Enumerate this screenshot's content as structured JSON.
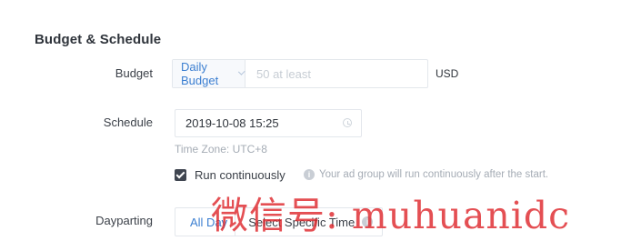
{
  "section": {
    "title": "Budget & Schedule"
  },
  "budget": {
    "label": "Budget",
    "type_selected": "Daily Budget",
    "amount_placeholder": "50 at least",
    "currency": "USD"
  },
  "schedule": {
    "label": "Schedule",
    "start_datetime": "2019-10-08 15:25",
    "timezone": "Time Zone: UTC+8",
    "run_continuously": {
      "checked": true,
      "label": "Run continuously",
      "hint": "Your ad group will run continuously after the start."
    }
  },
  "dayparting": {
    "label": "Dayparting",
    "options": [
      "All Day",
      "Select Specific Time"
    ],
    "selected": "All Day"
  },
  "icons": {
    "budget_chevron": "chevron-down-icon",
    "schedule_clock": "clock-icon",
    "run_hint": "info-icon",
    "dayparting_hint": "info-icon"
  },
  "colors": {
    "accent": "#3c7fd1",
    "checkbox_fill": "#3f4550",
    "muted_text": "#a5acb5",
    "watermark": "#de282d"
  },
  "watermark": {
    "text": "微信号: muhuanidc"
  }
}
